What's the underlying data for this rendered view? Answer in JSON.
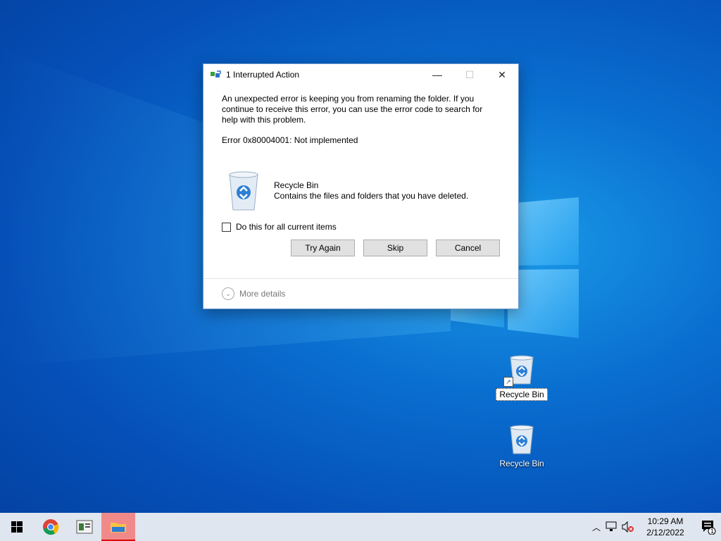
{
  "desktop": {
    "icons": [
      {
        "label": "Recycle Bin",
        "shortcut": true,
        "selected": true
      },
      {
        "label": "Recycle Bin",
        "shortcut": false,
        "selected": false
      }
    ]
  },
  "dialog": {
    "title": "1 Interrupted Action",
    "message": "An unexpected error is keeping you from renaming the folder. If you continue to receive this error, you can use the error code to search for help with this problem.",
    "error": "Error 0x80004001: Not implemented",
    "item_name": "Recycle Bin",
    "item_desc": "Contains the files and folders that you have deleted.",
    "checkbox_label": "Do this for all current items",
    "checkbox_checked": false,
    "buttons": {
      "try_again": "Try Again",
      "skip": "Skip",
      "cancel": "Cancel"
    },
    "more_details": "More details"
  },
  "taskbar": {
    "apps": [
      "start-icon",
      "chrome-icon",
      "app-icon",
      "file-explorer-icon"
    ],
    "clock_time": "10:29 AM",
    "clock_date": "2/12/2022",
    "notification_count": "1"
  },
  "colors": {
    "accent": "#0a6fd0",
    "taskbar": "#dfe6ef",
    "active_app": "#f08a8a"
  }
}
